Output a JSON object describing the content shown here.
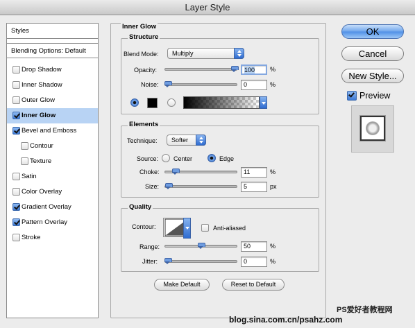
{
  "window": {
    "title": "Layer Style"
  },
  "styles_panel": {
    "header": "Styles",
    "blending": "Blending Options: Default",
    "items": [
      {
        "label": "Drop Shadow",
        "checked": false
      },
      {
        "label": "Inner Shadow",
        "checked": false
      },
      {
        "label": "Outer Glow",
        "checked": false
      },
      {
        "label": "Inner Glow",
        "checked": true,
        "selected": true
      },
      {
        "label": "Bevel and Emboss",
        "checked": true
      },
      {
        "label": "Contour",
        "checked": false,
        "sub": true
      },
      {
        "label": "Texture",
        "checked": false,
        "sub": true
      },
      {
        "label": "Satin",
        "checked": false
      },
      {
        "label": "Color Overlay",
        "checked": false
      },
      {
        "label": "Gradient Overlay",
        "checked": true
      },
      {
        "label": "Pattern Overlay",
        "checked": true
      },
      {
        "label": "Stroke",
        "checked": false
      }
    ]
  },
  "main": {
    "section_title": "Inner Glow",
    "structure": {
      "title": "Structure",
      "blend_mode_label": "Blend Mode:",
      "blend_mode_value": "Multiply",
      "opacity_label": "Opacity:",
      "opacity_value": "100",
      "opacity_pct": 100,
      "noise_label": "Noise:",
      "noise_value": "0",
      "noise_pct": 0,
      "unit": "%"
    },
    "elements": {
      "title": "Elements",
      "technique_label": "Technique:",
      "technique_value": "Softer",
      "source_label": "Source:",
      "source_center": "Center",
      "source_edge": "Edge",
      "choke_label": "Choke:",
      "choke_value": "11",
      "choke_pct": 11,
      "size_label": "Size:",
      "size_value": "5",
      "size_unit": "px",
      "unit": "%"
    },
    "quality": {
      "title": "Quality",
      "contour_label": "Contour:",
      "anti_aliased_label": "Anti-aliased",
      "range_label": "Range:",
      "range_value": "50",
      "range_pct": 50,
      "jitter_label": "Jitter:",
      "jitter_value": "0",
      "jitter_pct": 0,
      "unit": "%"
    },
    "make_default": "Make Default",
    "reset_default": "Reset to Default"
  },
  "actions": {
    "ok": "OK",
    "cancel": "Cancel",
    "new_style": "New Style...",
    "preview": "Preview",
    "preview_checked": true
  },
  "watermark": {
    "line1": "PS爱好者教程网",
    "line2": "blog.sina.com.cn/psahz.com"
  },
  "colors": {
    "selection": "#b8d3f4",
    "accent": "#3c74cc",
    "glow_color": "#000000"
  }
}
